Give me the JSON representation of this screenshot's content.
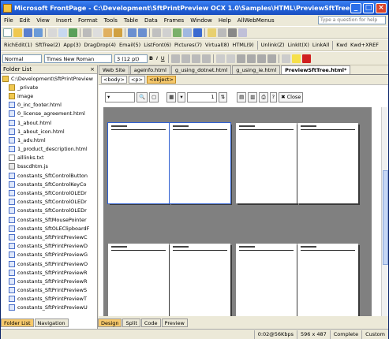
{
  "window": {
    "title": "Microsoft FrontPage - C:\\Development\\SftPrintPreview OCX 1.0\\Samples\\HTML\\PreviewSftTree.html"
  },
  "menu": [
    "File",
    "Edit",
    "View",
    "Insert",
    "Format",
    "Tools",
    "Table",
    "Data",
    "Frames",
    "Window",
    "Help",
    "AllWebMenus"
  ],
  "help_placeholder": "Type a question for help",
  "toolbar2": {
    "richedit": "RichEdit(1)",
    "sfttree": "SftTree(2)",
    "app": "App(3)",
    "dragdrop": "DragDrop(4)",
    "email": "Email(5)",
    "listfont": "ListFont(6)",
    "pictures": "Pictures(7)",
    "virtual": "Virtual(8)",
    "html": "HTML(9)",
    "unlink": "Unlink(Z)",
    "linkit": "LinkIt(X)",
    "linkall": "LinkAll",
    "kwd": "Kwd",
    "kwdxref": "Kwd+XREF"
  },
  "format": {
    "style": "Normal",
    "font": "Times New Roman",
    "size": "3 (12 pt)"
  },
  "folderlist": {
    "title": "Folder List",
    "root": "C:\\Development\\SftPrintPreview",
    "items": [
      {
        "name": "_private",
        "type": "folder"
      },
      {
        "name": "image",
        "type": "folder"
      },
      {
        "name": "0_inc_footer.html",
        "type": "htm"
      },
      {
        "name": "0_license_agreement.html",
        "type": "htm"
      },
      {
        "name": "1_about.html",
        "type": "htm"
      },
      {
        "name": "1_about_icon.html",
        "type": "htm"
      },
      {
        "name": "1_adv.html",
        "type": "htm"
      },
      {
        "name": "1_product_description.html",
        "type": "htm"
      },
      {
        "name": "alllinks.txt",
        "type": "txt"
      },
      {
        "name": "bsscdhtm.js",
        "type": "js"
      },
      {
        "name": "constants_SftControlButton",
        "type": "htm"
      },
      {
        "name": "constants_SftControlKeyCo",
        "type": "htm"
      },
      {
        "name": "constants_SftControlOLEDr",
        "type": "htm"
      },
      {
        "name": "constants_SftControlOLEDr",
        "type": "htm"
      },
      {
        "name": "constants_SftControlOLEDr",
        "type": "htm"
      },
      {
        "name": "constants_SftMousePointer",
        "type": "htm"
      },
      {
        "name": "constants_SftOLEClipboardF",
        "type": "htm"
      },
      {
        "name": "constants_SftPrintPreviewC",
        "type": "htm"
      },
      {
        "name": "constants_SftPrintPreviewD",
        "type": "htm"
      },
      {
        "name": "constants_SftPrintPreviewG",
        "type": "htm"
      },
      {
        "name": "constants_SftPrintPreviewO",
        "type": "htm"
      },
      {
        "name": "constants_SftPrintPreviewR",
        "type": "htm"
      },
      {
        "name": "constants_SftPrintPreviewR",
        "type": "htm"
      },
      {
        "name": "constants_SftPrintPreviewS",
        "type": "htm"
      },
      {
        "name": "constants_SftPrintPreviewT",
        "type": "htm"
      },
      {
        "name": "constants_SftPrintPreviewU",
        "type": "htm"
      }
    ]
  },
  "doc_tabs": [
    "Web Site",
    "ageInfo.html",
    "g_using_dotnet.html",
    "g_using_ie.html",
    "PreviewSftTree.html*"
  ],
  "tag_selector": [
    "<body>",
    "<p>",
    "<object>"
  ],
  "preview_toolbar": {
    "page": "1",
    "close": "Close"
  },
  "view_tabs": [
    "Design",
    "Split",
    "Code",
    "Preview"
  ],
  "folder_tabs": [
    "Folder List",
    "Navigation"
  ],
  "status": {
    "speed": "0:02@56Kbps",
    "size": "596 x 487",
    "state": "Complete",
    "mode": "Custom"
  }
}
